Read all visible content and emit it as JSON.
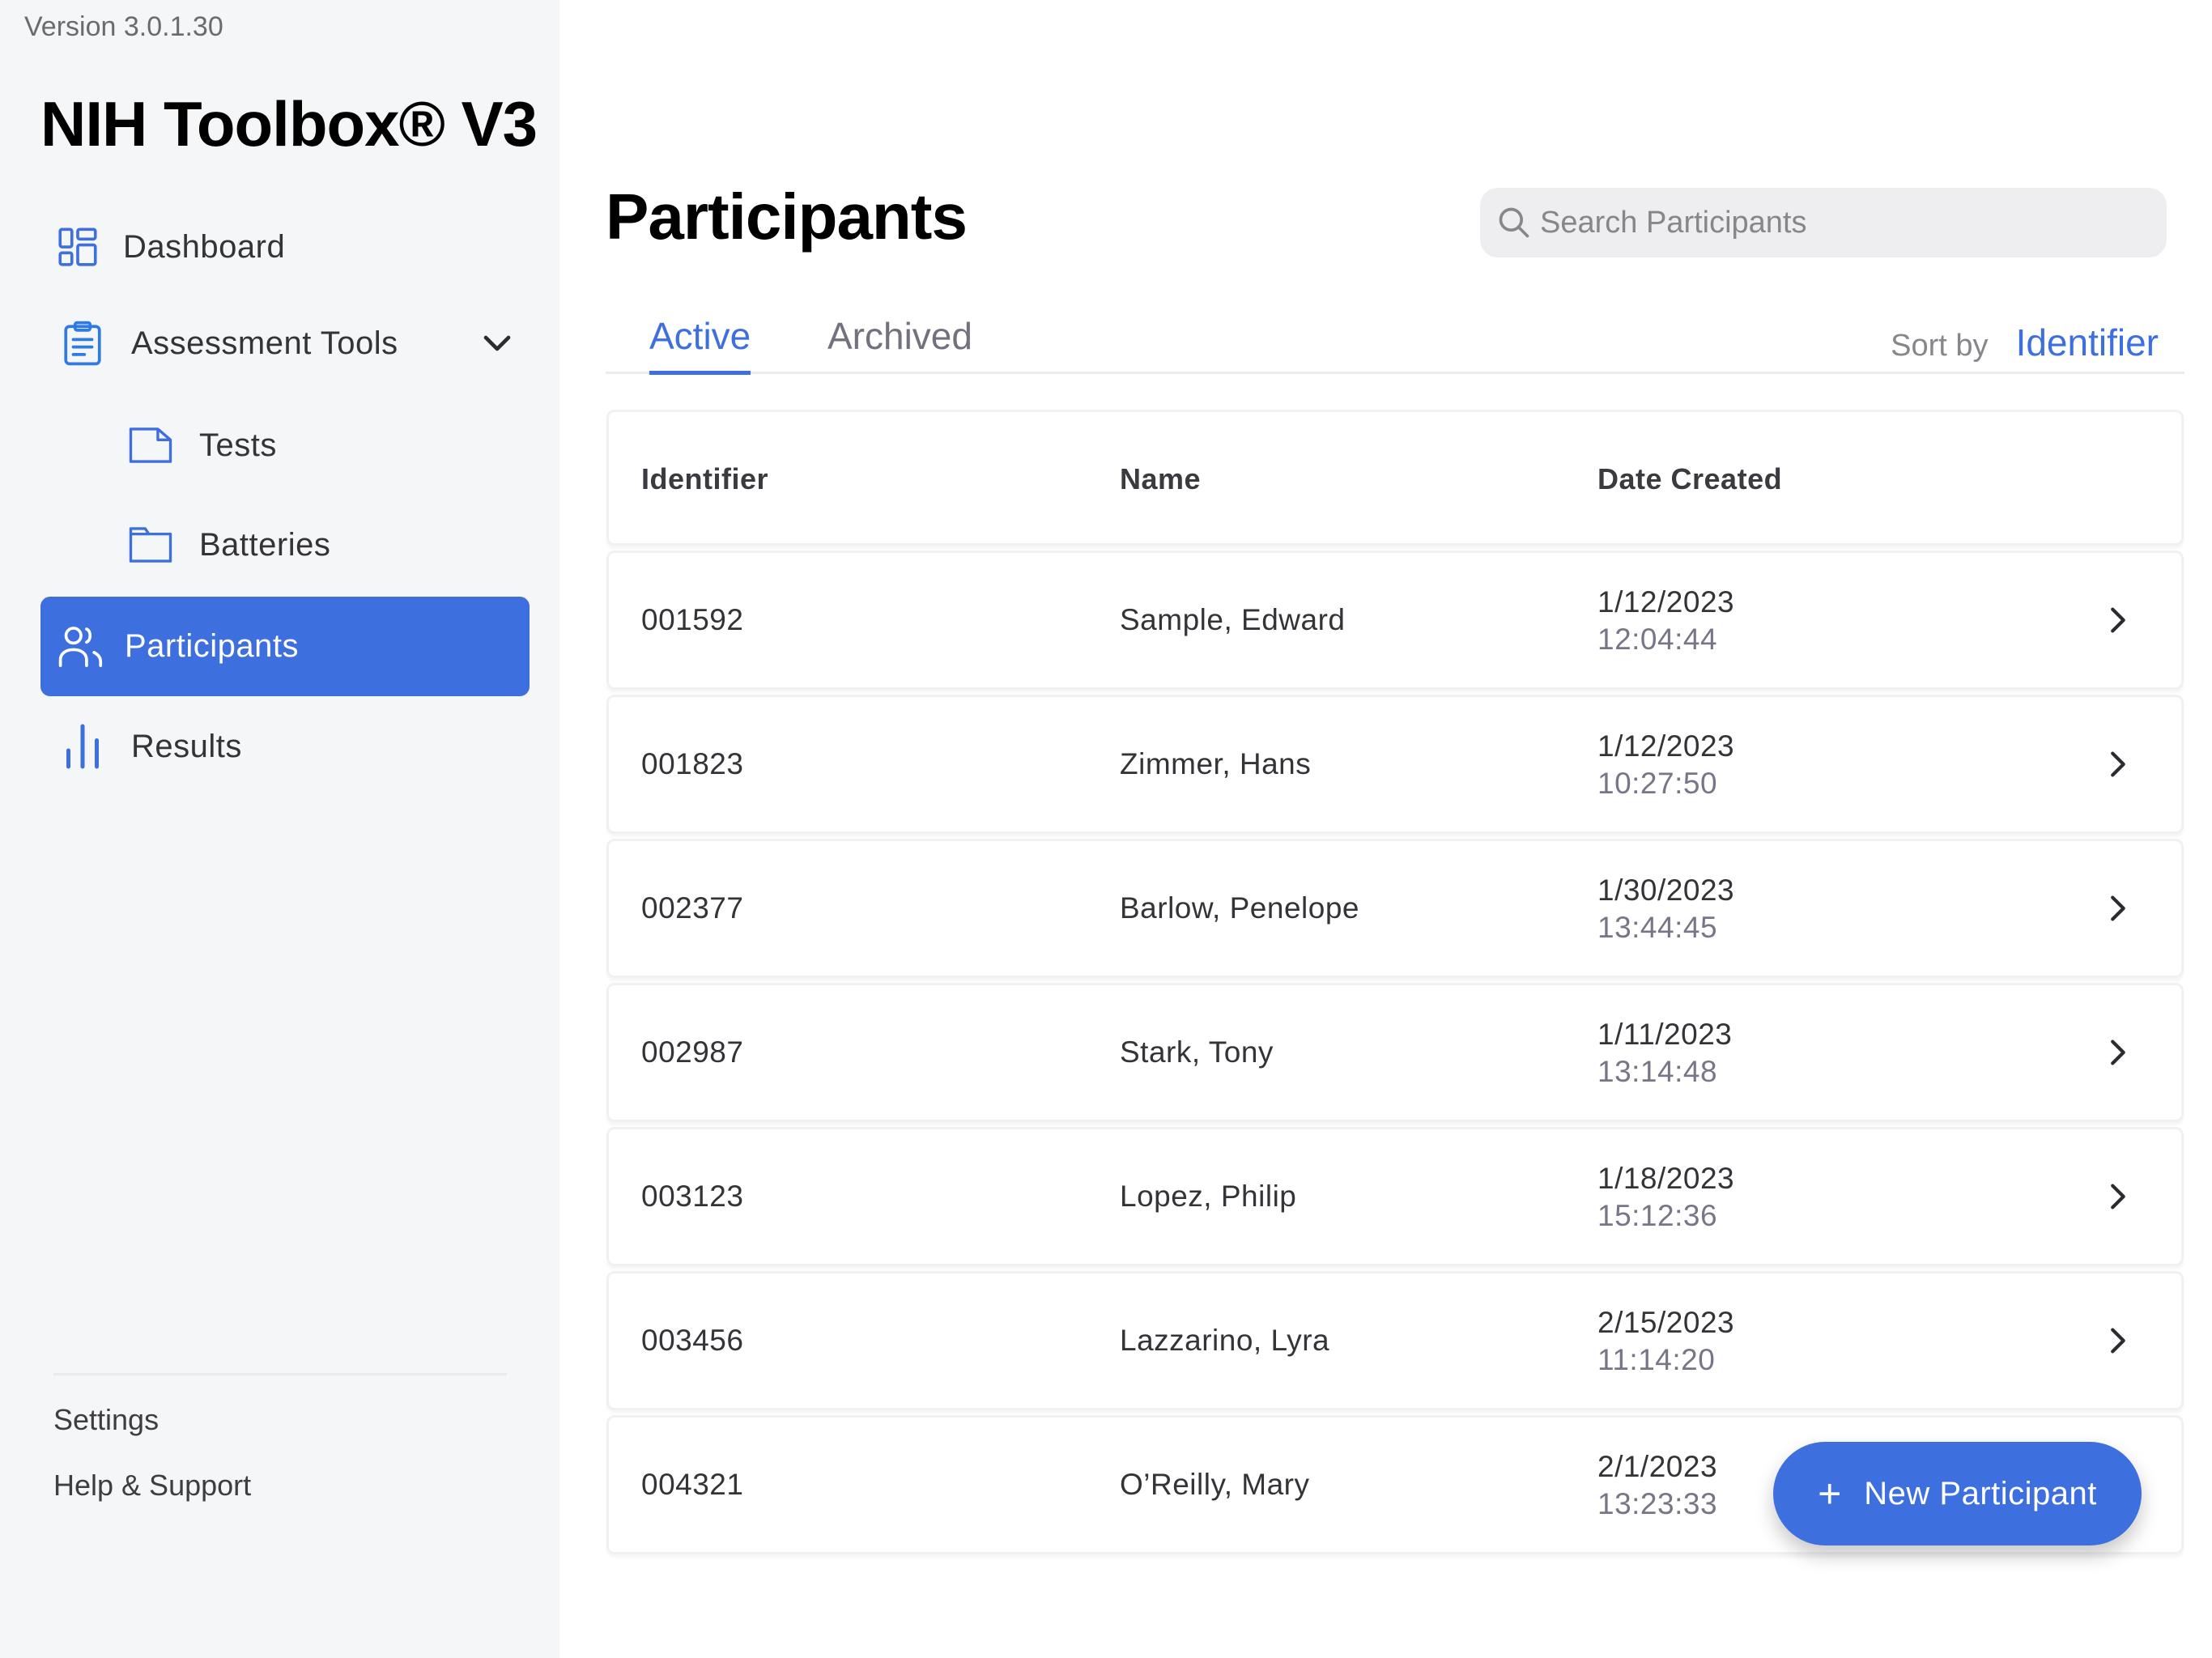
{
  "app": {
    "version": "Version 3.0.1.30",
    "title": "NIH Toolbox® V3"
  },
  "sidebar": {
    "items": [
      {
        "label": "Dashboard",
        "icon": "dashboard-icon"
      },
      {
        "label": "Assessment Tools",
        "icon": "clipboard-icon",
        "expanded": true
      },
      {
        "label": "Tests",
        "icon": "document-icon"
      },
      {
        "label": "Batteries",
        "icon": "folder-icon"
      },
      {
        "label": "Participants",
        "icon": "users-icon",
        "active": true
      },
      {
        "label": "Results",
        "icon": "bar-chart-icon"
      }
    ],
    "footer": {
      "settings": "Settings",
      "help": "Help & Support"
    }
  },
  "main": {
    "title": "Participants",
    "search": {
      "placeholder": "Search Participants",
      "value": ""
    },
    "tabs": [
      {
        "label": "Active",
        "active": true
      },
      {
        "label": "Archived",
        "active": false
      }
    ],
    "sort": {
      "label": "Sort by",
      "value": "Identifier"
    },
    "table": {
      "columns": [
        "Identifier",
        "Name",
        "Date Created"
      ],
      "rows": [
        {
          "id": "001592",
          "name": "Sample, Edward",
          "date": "1/12/2023",
          "time": "12:04:44"
        },
        {
          "id": "001823",
          "name": "Zimmer, Hans",
          "date": "1/12/2023",
          "time": "10:27:50"
        },
        {
          "id": "002377",
          "name": "Barlow, Penelope",
          "date": "1/30/2023",
          "time": "13:44:45"
        },
        {
          "id": "002987",
          "name": "Stark, Tony",
          "date": "1/11/2023",
          "time": "13:14:48"
        },
        {
          "id": "003123",
          "name": "Lopez, Philip",
          "date": "1/18/2023",
          "time": "15:12:36"
        },
        {
          "id": "003456",
          "name": "Lazzarino, Lyra",
          "date": "2/15/2023",
          "time": "11:14:20"
        },
        {
          "id": "004321",
          "name": "O’Reilly, Mary",
          "date": "2/1/2023",
          "time": "13:23:33"
        }
      ]
    },
    "new_button": {
      "icon": "+",
      "label": "New Participant"
    }
  },
  "colors": {
    "accent": "#3e6fde",
    "sidebar_bg": "#f5f6f8",
    "text_primary": "#333338",
    "text_secondary": "#767686"
  }
}
